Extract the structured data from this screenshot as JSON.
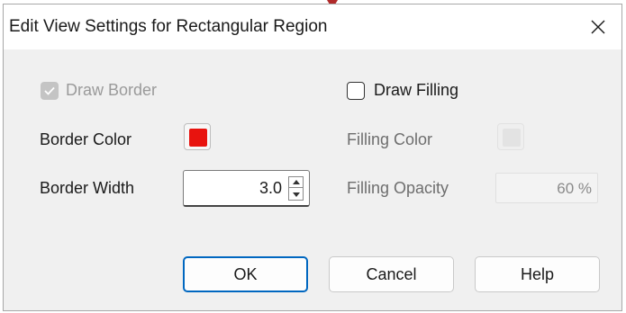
{
  "dialog": {
    "title": "Edit View Settings for Rectangular Region",
    "close_icon": "close-icon"
  },
  "draw_border": {
    "label": "Draw Border",
    "checked": true,
    "disabled": true
  },
  "draw_filling": {
    "label": "Draw Filling",
    "checked": false,
    "disabled": false
  },
  "border_color": {
    "label": "Border Color",
    "color": "#e8130e"
  },
  "filling_color": {
    "label": "Filling Color",
    "color": "#e3e3e3",
    "disabled": true
  },
  "border_width": {
    "label": "Border Width",
    "value": "3.0"
  },
  "filling_opacity": {
    "label": "Filling Opacity",
    "value": "60 %",
    "disabled": true
  },
  "buttons": {
    "ok": "OK",
    "cancel": "Cancel",
    "help": "Help"
  },
  "colors": {
    "accent": "#0067c0",
    "window_bg": "#f0f0f0"
  }
}
